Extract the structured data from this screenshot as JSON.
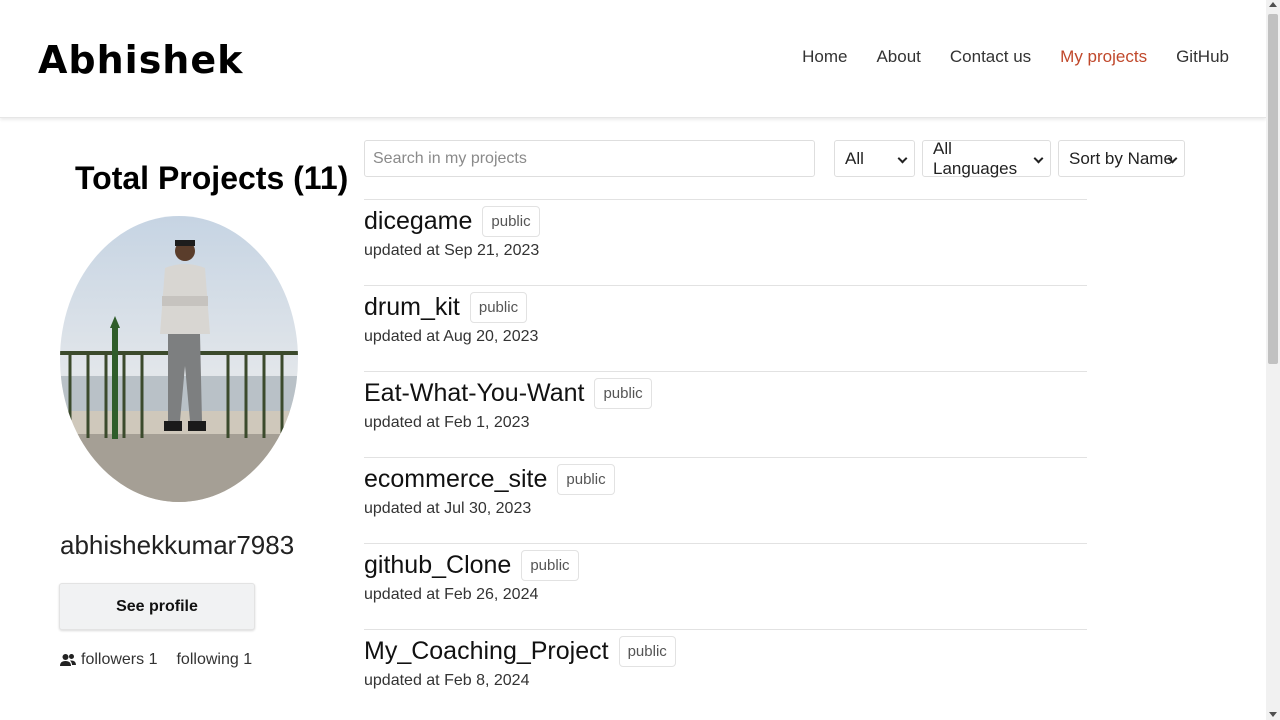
{
  "brand": "Abhishek",
  "nav": {
    "items": [
      "Home",
      "About",
      "Contact us",
      "My projects",
      "GitHub"
    ],
    "active_index": 3,
    "active_color": "#c0482b"
  },
  "sidebar": {
    "total_label": "Total Projects (11)",
    "username": "abhishekkumar7983",
    "see_profile": "See profile",
    "followers": "followers 1",
    "following": "following 1",
    "followers_icon": "people-icon"
  },
  "filters": {
    "search_placeholder": "Search in my projects",
    "type_value": "All",
    "language_value": "All Languages",
    "sort_value": "Sort by Name"
  },
  "projects": [
    {
      "name": "dicegame",
      "visibility": "public",
      "updated": "updated at Sep 21, 2023"
    },
    {
      "name": "drum_kit",
      "visibility": "public",
      "updated": "updated at Aug 20, 2023"
    },
    {
      "name": "Eat-What-You-Want",
      "visibility": "public",
      "updated": "updated at Feb 1, 2023"
    },
    {
      "name": "ecommerce_site",
      "visibility": "public",
      "updated": "updated at Jul 30, 2023"
    },
    {
      "name": "github_Clone",
      "visibility": "public",
      "updated": "updated at Feb 26, 2024"
    },
    {
      "name": "My_Coaching_Project",
      "visibility": "public",
      "updated": "updated at Feb 8, 2024"
    }
  ]
}
